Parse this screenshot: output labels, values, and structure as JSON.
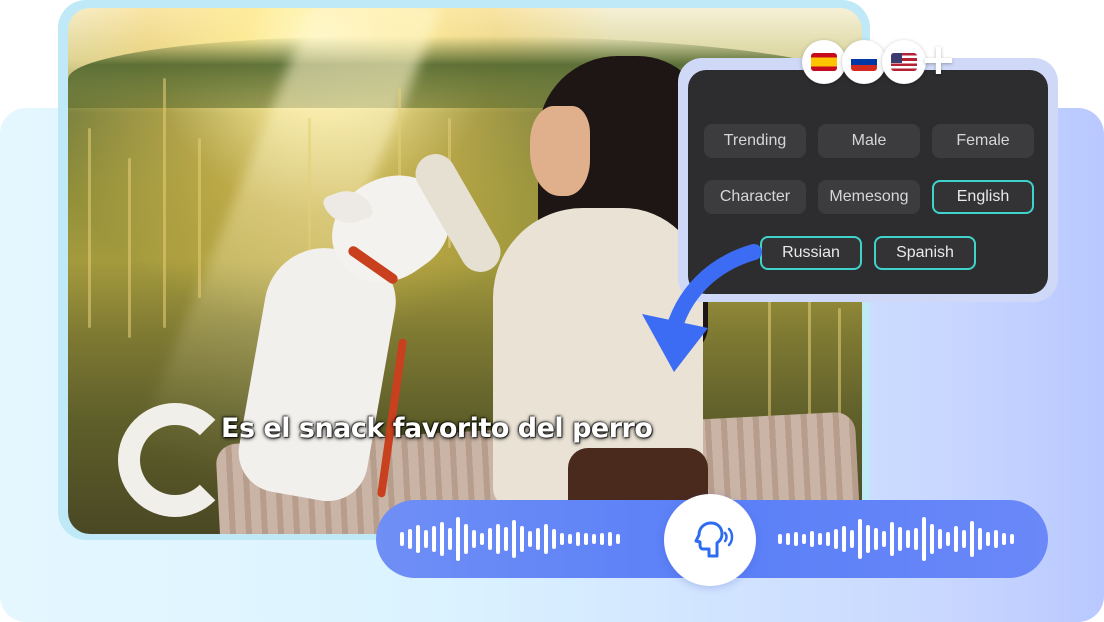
{
  "subtitle": "Es el snack favorito del perro",
  "voice_panel": {
    "tags": [
      {
        "label": "Trending",
        "selected": false
      },
      {
        "label": "Male",
        "selected": false
      },
      {
        "label": "Female",
        "selected": false
      },
      {
        "label": "Character",
        "selected": false
      },
      {
        "label": "Memesong",
        "selected": false
      },
      {
        "label": "English",
        "selected": true
      },
      {
        "label": "Russian",
        "selected": true
      },
      {
        "label": "Spanish",
        "selected": true
      }
    ]
  },
  "languages": {
    "flags": [
      "spain-flag-icon",
      "russia-flag-icon",
      "usa-flag-icon"
    ],
    "more": "+"
  },
  "colors": {
    "accent_teal": "#3fd3cc",
    "wave_blue": "#5a7ff7",
    "arrow_blue": "#3b6cf3",
    "panel_dark": "#2d2d2f"
  }
}
